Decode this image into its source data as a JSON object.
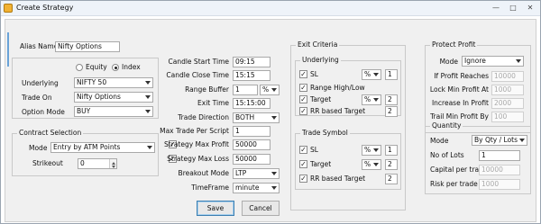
{
  "window": {
    "title": "Create Strategy"
  },
  "alias": {
    "label": "Alias Name",
    "value": "Nifty Options"
  },
  "instrument": {
    "equity_label": "Equity",
    "index_label": "Index",
    "selected": "Index",
    "underlying_label": "Underlying",
    "underlying_value": "NIFTY 50",
    "trade_on_label": "Trade On",
    "trade_on_value": "Nifty Options",
    "option_mode_label": "Option Mode",
    "option_mode_value": "BUY"
  },
  "contract": {
    "title": "Contract Selection",
    "mode_label": "Mode",
    "mode_value": "Entry by ATM Points",
    "strikeout_label": "Strikeout",
    "strikeout_value": "0"
  },
  "timing": {
    "candle_start_label": "Candle Start Time",
    "candle_start_value": "09:15",
    "candle_close_label": "Candle Close Time",
    "candle_close_value": "15:15",
    "range_buffer_label": "Range Buffer",
    "range_buffer_value": "1",
    "range_buffer_unit": "%",
    "exit_time_label": "Exit Time",
    "exit_time_value": "15:15:00",
    "trade_direction_label": "Trade Direction",
    "trade_direction_value": "BOTH",
    "max_trade_label": "Max Trade Per Script",
    "max_trade_value": "1",
    "max_profit_label": "Strategy Max Profit",
    "max_profit_value": "50000",
    "max_loss_label": "Strategy Max Loss",
    "max_loss_value": "50000",
    "breakout_mode_label": "Breakout Mode",
    "breakout_mode_value": "LTP",
    "timeframe_label": "TimeFrame",
    "timeframe_value": "minute"
  },
  "exit_criteria": {
    "title": "Exit Criteria",
    "underlying": {
      "title": "Underlying",
      "sl_label": "SL",
      "sl_unit": "%",
      "sl_value": "1",
      "range_label": "Range High/Low",
      "target_label": "Target",
      "target_unit": "%",
      "target_value": "2",
      "rr_label": "RR based Target",
      "rr_value": "2"
    },
    "trade_symbol": {
      "title": "Trade Symbol",
      "sl_label": "SL",
      "sl_unit": "%",
      "sl_value": "1",
      "target_label": "Target",
      "target_unit": "%",
      "target_value": "2",
      "rr_label": "RR based Target",
      "rr_value": "2"
    }
  },
  "protect_profit": {
    "title": "Protect Profit",
    "mode_label": "Mode",
    "mode_value": "Ignore",
    "if_profit_label": "If Profit Reaches",
    "if_profit_value": "10000",
    "lock_min_label": "Lock Min Profit At",
    "lock_min_value": "1000",
    "increase_label": "Increase In Profit",
    "increase_value": "2000",
    "trail_label": "Trail Min Profit By",
    "trail_value": "100"
  },
  "quantity": {
    "title": "Quantity",
    "mode_label": "Mode",
    "mode_value": "By Qty / Lots",
    "lots_label": "No of Lots",
    "lots_value": "1",
    "capital_label": "Capital per trade",
    "capital_value": "10000",
    "risk_label": "Risk per trade",
    "risk_value": "1000"
  },
  "buttons": {
    "save": "Save",
    "cancel": "Cancel"
  }
}
